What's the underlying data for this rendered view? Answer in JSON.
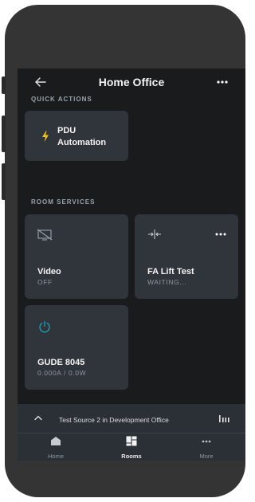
{
  "header": {
    "title": "Home Office",
    "back_icon": "arrow-left-icon",
    "menu_icon": "more-horizontal-icon"
  },
  "quick_actions": {
    "label": "QUICK ACTIONS",
    "items": [
      {
        "name_line1": "PDU",
        "name_line2": "Automation",
        "icon": "lightning-bolt-icon",
        "icon_color": "#f5c518"
      }
    ]
  },
  "room_services": {
    "label": "ROOM SERVICES",
    "tiles": [
      {
        "name": "Video",
        "status": "OFF",
        "icon": "display-off-icon"
      },
      {
        "name": "FA Lift Test",
        "status": "WAITING...",
        "icon": "collapse-arrows-icon",
        "menu_icon": "more-horizontal-icon"
      },
      {
        "name": "GUDE 8045",
        "status": "0.000A / 0.0W",
        "icon": "power-icon",
        "icon_color": "#1aa3b5"
      }
    ]
  },
  "now_playing": {
    "text": "Test Source 2 in Development Office",
    "expand_icon": "chevron-up-icon",
    "level_icon": "audio-levels-icon"
  },
  "nav": {
    "items": [
      {
        "label": "Home",
        "icon": "home-icon",
        "active": false
      },
      {
        "label": "Rooms",
        "icon": "rooms-grid-icon",
        "active": true
      },
      {
        "label": "More",
        "icon": "more-horizontal-icon",
        "active": false
      }
    ]
  }
}
